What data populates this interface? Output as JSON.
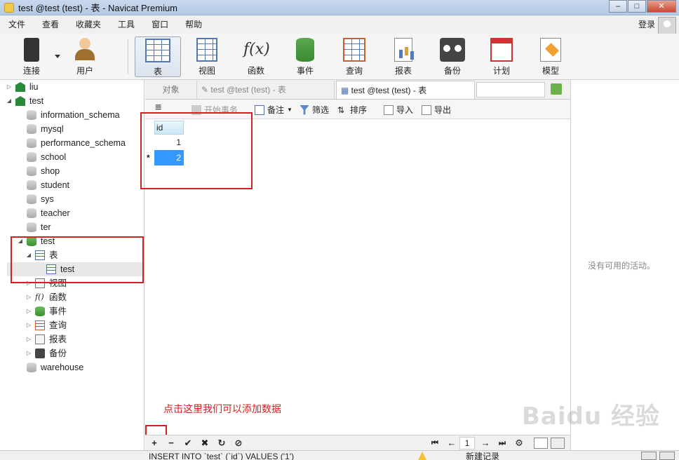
{
  "window": {
    "title": "test @test (test) - 表 - Navicat Premium"
  },
  "menu": [
    "文件",
    "查看",
    "收藏夹",
    "工具",
    "窗口",
    "帮助"
  ],
  "login": "登录",
  "toolbar": {
    "connect": "连接",
    "user": "用户",
    "table": "表",
    "view": "视图",
    "function": "函数",
    "event": "事件",
    "query": "查询",
    "report": "报表",
    "backup": "备份",
    "schedule": "计划",
    "model": "模型"
  },
  "tree": {
    "conn1": "liu",
    "conn2": "test",
    "dbs": [
      "information_schema",
      "mysql",
      "performance_schema",
      "school",
      "shop",
      "student",
      "sys",
      "teacher",
      "ter"
    ],
    "open_db": "test",
    "tables_node": "表",
    "table_item": "test",
    "children": [
      "视图",
      "函数",
      "事件",
      "查询",
      "报表",
      "备份"
    ],
    "last_db": "warehouse"
  },
  "tabs": {
    "objects": "对象",
    "tab1": "test @test (test) - 表",
    "tab2": "test @test (test) - 表"
  },
  "objtoolbar": {
    "begin_tx": "开始事务",
    "note": "备注",
    "filter": "筛选",
    "sort": "排序",
    "import": "导入",
    "export": "导出"
  },
  "grid": {
    "column": "id",
    "rows": [
      "1",
      "2"
    ],
    "new_row_marker": "*"
  },
  "annotation": "点击这里我们可以添加数据",
  "pager": {
    "page": "1"
  },
  "right_panel": {
    "empty_text": "没有可用的活动。"
  },
  "status": {
    "sql": "INSERT INTO `test` (`id`) VALUES ('1')",
    "mode": "新建记录"
  },
  "watermark": "Baidu 经验"
}
